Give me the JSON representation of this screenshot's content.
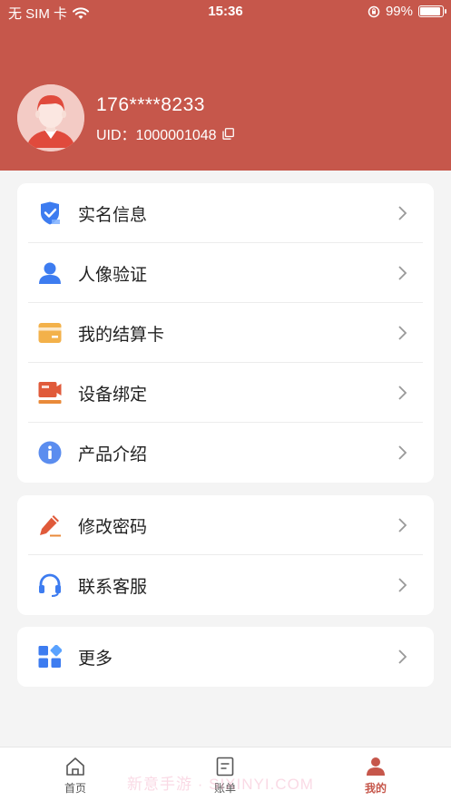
{
  "status_bar": {
    "carrier": "无 SIM 卡",
    "time": "15:36",
    "battery": "99%"
  },
  "profile": {
    "phone": "176****8233",
    "uid": "UID：1000001048"
  },
  "menu_group_1": [
    {
      "label": "实名信息",
      "icon": "shield-check-icon"
    },
    {
      "label": "人像验证",
      "icon": "person-icon"
    },
    {
      "label": "我的结算卡",
      "icon": "card-icon"
    },
    {
      "label": "设备绑定",
      "icon": "device-icon"
    },
    {
      "label": "产品介绍",
      "icon": "info-icon"
    }
  ],
  "menu_group_2": [
    {
      "label": "修改密码",
      "icon": "pencil-icon"
    },
    {
      "label": "联系客服",
      "icon": "headset-icon"
    }
  ],
  "menu_group_3": [
    {
      "label": "更多",
      "icon": "grid-icon"
    }
  ],
  "tabbar": {
    "home": "首页",
    "bill": "账单",
    "mine": "我的"
  },
  "watermark": "新意手游 · SIXINYI.COM",
  "colors": {
    "header": "#c6574b",
    "accent_blue": "#3d7cf0",
    "accent_orange": "#e98a3a",
    "accent_red": "#e05a3a"
  }
}
